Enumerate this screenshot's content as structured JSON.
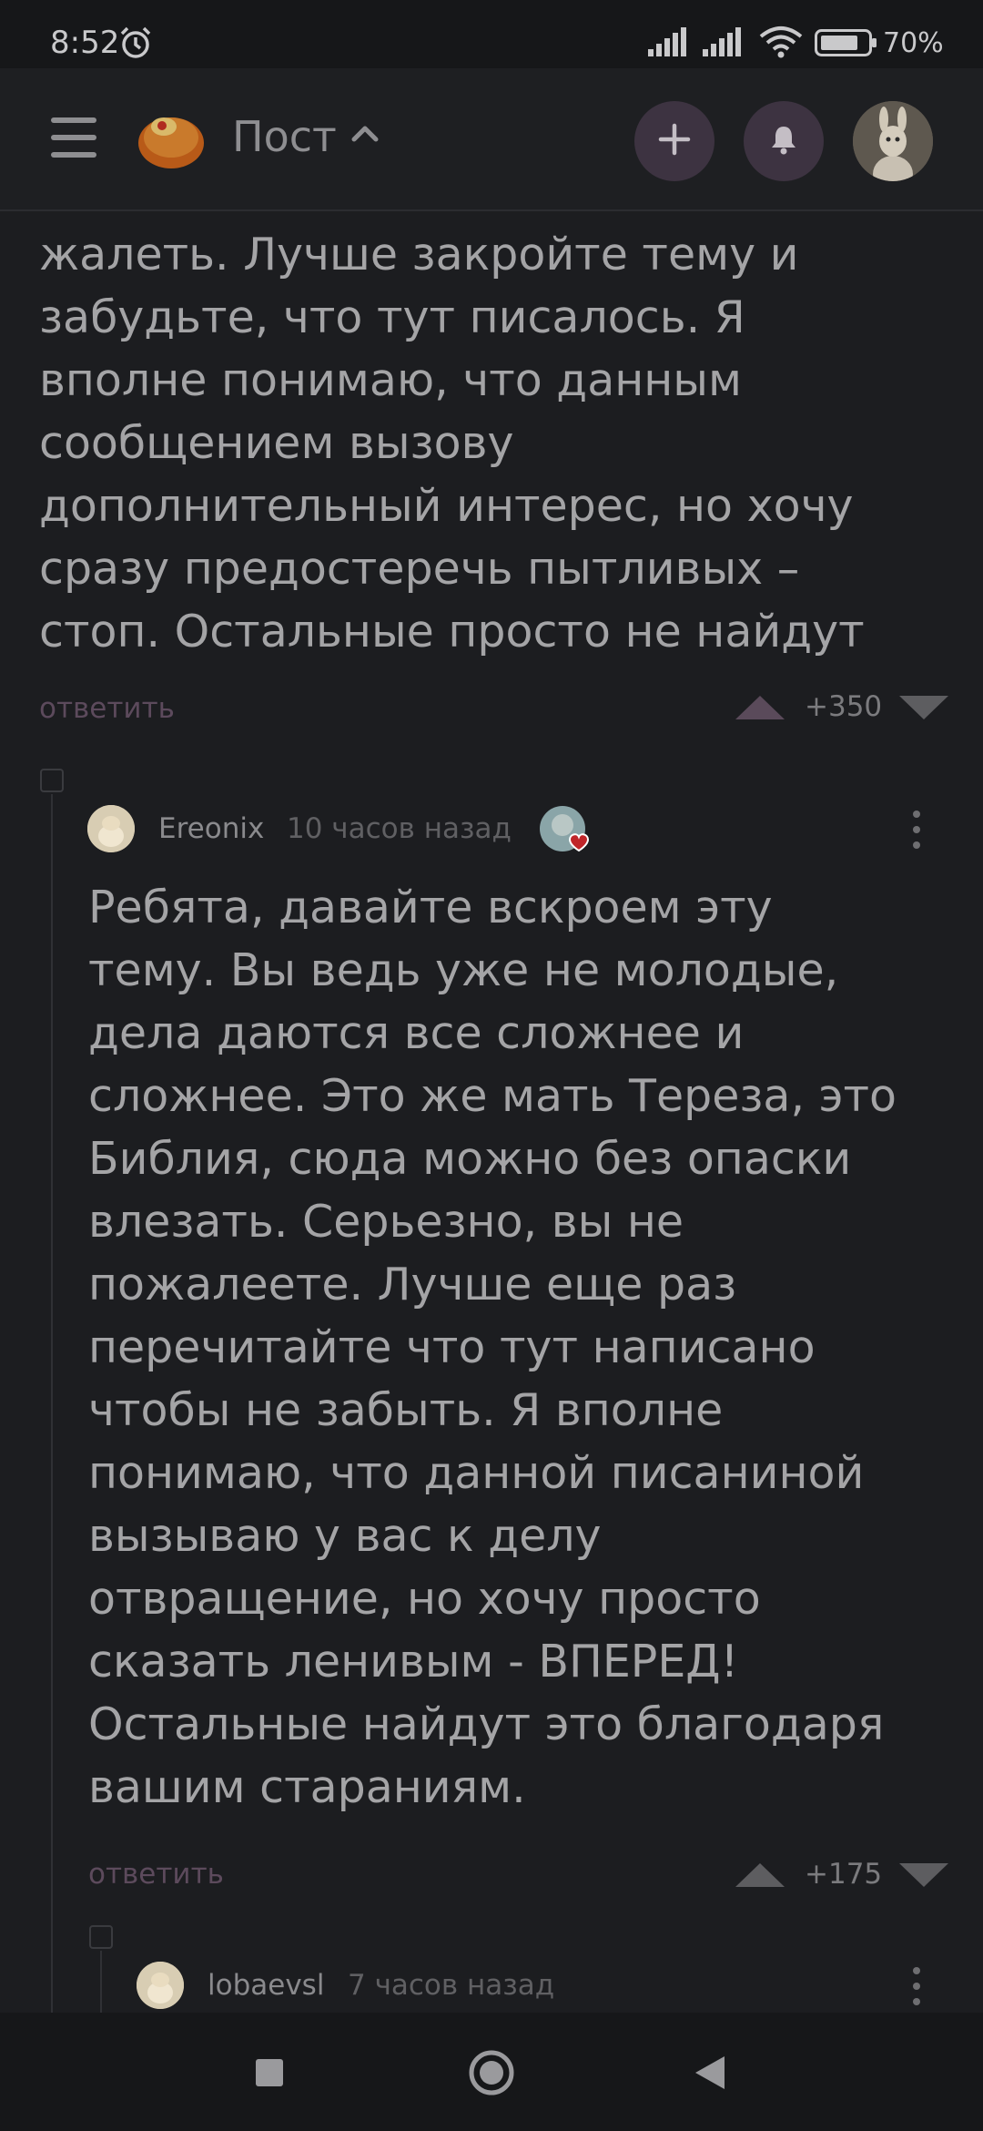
{
  "status_bar": {
    "time": "8:52",
    "battery": "70%",
    "icons": [
      "alarm-icon",
      "signal-icon",
      "signal-icon",
      "wifi-icon",
      "battery-icon"
    ]
  },
  "header": {
    "title": "Пост",
    "icons": [
      "menu-icon",
      "logo-icon",
      "chevron-up-icon",
      "plus-icon",
      "bell-icon"
    ]
  },
  "comments": [
    {
      "text_lines": [
        "жалеть. Лучше закройте тему и",
        "забудьте, что тут писалось. Я",
        "вполне понимаю, что данным",
        "сообщением вызову",
        "дополнительный интерес, но хочу",
        "сразу предостеречь пытливых –",
        "стоп. Остальные просто не найдут"
      ],
      "reply_label": "ответить",
      "votes": "+350"
    },
    {
      "author": "Ereonix",
      "time": "10 часов назад",
      "text_lines": [
        "Ребята, давайте вскроем эту",
        "тему. Вы ведь уже не молодые,",
        "дела даются все сложнее и",
        "сложнее. Это же мать Тереза, это",
        "Библия, сюда можно без опаски",
        "влезать. Серьезно, вы не",
        "пожалеете. Лучше еще раз",
        "перечитайте что тут написано",
        "чтобы не забыть. Я вполне",
        "понимаю, что данной писаниной",
        "вызываю у вас к делу",
        "отвращение, но хочу просто",
        "сказать ленивым - ВПЕРЕД!",
        "Остальные найдут это благодаря",
        "вашим стараниям."
      ],
      "reply_label": "ответить",
      "votes": "+175"
    },
    {
      "author": "lobaevsl",
      "time": "7 часов назад"
    }
  ],
  "colors": {
    "background": "#1c1d20",
    "accent_button": "#3d3341",
    "reply_link": "#5c4a5c",
    "upvote": "#5a4a5a"
  }
}
